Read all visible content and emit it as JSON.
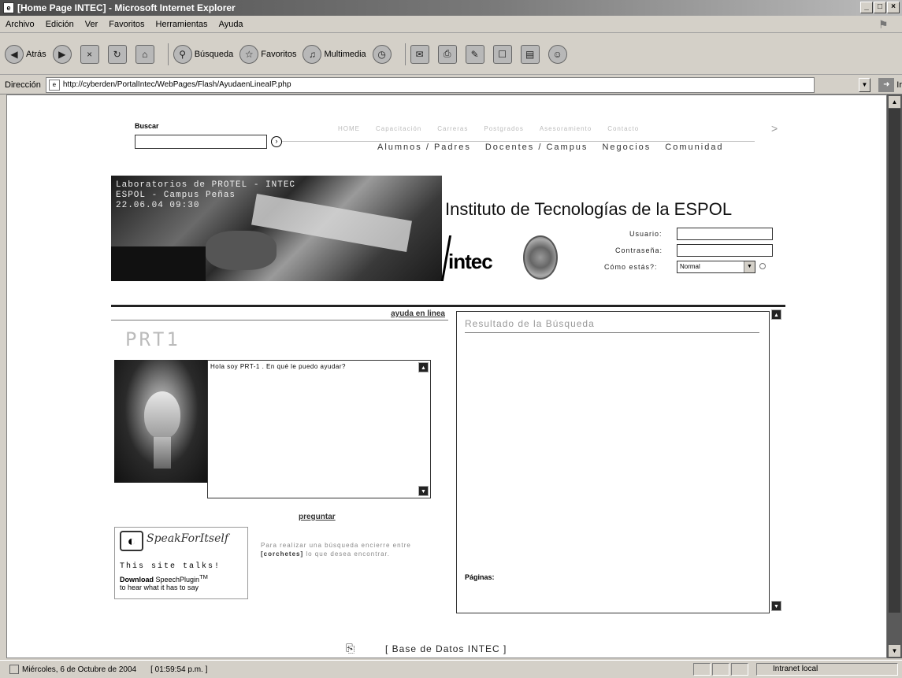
{
  "window": {
    "title": "[Home Page INTEC] - Microsoft Internet Explorer"
  },
  "menu": [
    "Archivo",
    "Edición",
    "Ver",
    "Favoritos",
    "Herramientas",
    "Ayuda"
  ],
  "toolbar": {
    "back": "Atrás",
    "search": "Búsqueda",
    "favorites": "Favoritos",
    "multimedia": "Multimedia"
  },
  "address": {
    "label": "Dirección",
    "url": "http://cyberden/PortalIntec/WebPages/Flash/AyudaenLineaIP.php",
    "go": "Ir"
  },
  "page": {
    "search_label": "Buscar",
    "top_nav": [
      "HOME",
      "Capacitación",
      "Carreras",
      "Postgrados",
      "Asesoramiento",
      "Contacto"
    ],
    "section_nav": [
      "Alumnos / Padres",
      "Docentes / Campus",
      "Negocios",
      "Comunidad"
    ],
    "photo_caption": [
      "Laboratorios de PROTEL - INTEC",
      "ESPOL - Campus Peñas",
      "22.06.04 09:30"
    ],
    "institute_title": "Instituto de Tecnologías de la ESPOL",
    "logo_text": "intec",
    "login": {
      "user_label": "Usuario:",
      "password_label": "Contraseña:",
      "status_label": "Cómo estás?:",
      "status_value": "Normal"
    },
    "help_link": "ayuda en linea",
    "prt_logo": "PRT1",
    "chat_text": "Hola soy PRT-1 . En qué le puedo ayudar?",
    "ask_link": "preguntar",
    "speak": {
      "script": "SpeakForItself",
      "line1": "This site talks!",
      "download": "Download",
      "plugin": "SpeechPlugin",
      "tm": "TM",
      "line3": "to hear what it has to say"
    },
    "hint_pre": "Para realizar una búsqueda encierre entre",
    "hint_bold": "[corchetes]",
    "hint_post": "lo que desea encontrar.",
    "results_title": "Resultado de la Búsqueda",
    "pages_label": "Páginas:",
    "db_link": "[ Base de Datos INTEC ]"
  },
  "status": {
    "date": "Miércoles, 6 de Octubre de 2004",
    "time": "[ 01:59:54 p.m. ]",
    "zone": "Intranet local"
  }
}
